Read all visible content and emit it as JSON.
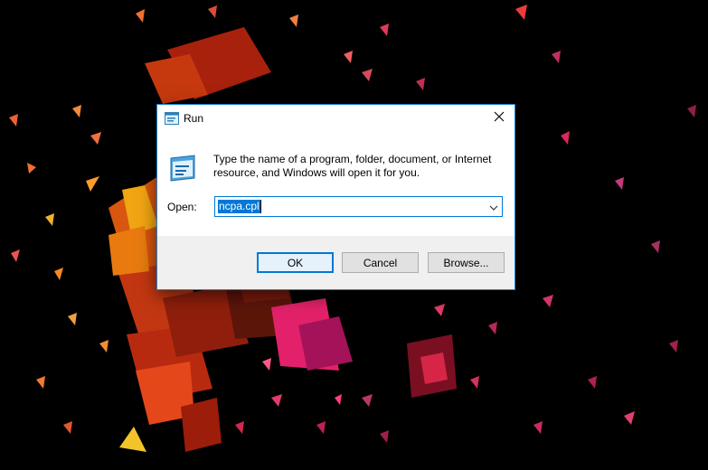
{
  "window": {
    "title": "Run",
    "close_icon": "close-icon"
  },
  "dialog": {
    "icon": "run-icon",
    "description": "Type the name of a program, folder, document, or Internet resource, and Windows will open it for you.",
    "open_label": "Open:",
    "open_value": "ncpa.cpl",
    "dropdown_icon": "chevron-down-icon"
  },
  "buttons": {
    "ok": "OK",
    "cancel": "Cancel",
    "browse": "Browse..."
  },
  "colors": {
    "accent": "#0078d7",
    "button_bar": "#f0f0f0",
    "wallpaper": "#000000"
  }
}
